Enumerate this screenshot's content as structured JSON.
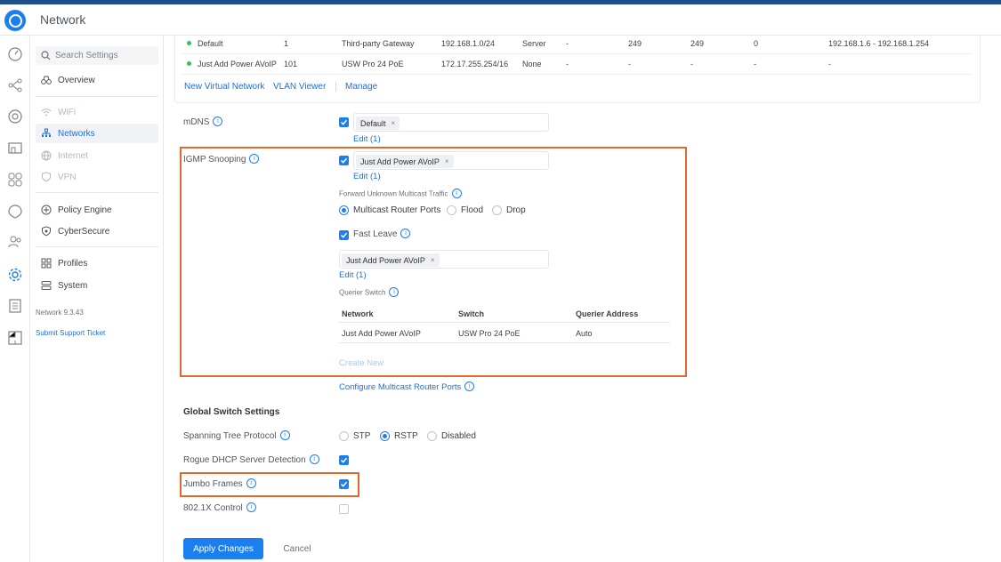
{
  "app": {
    "title": "Network"
  },
  "colors": {
    "accent": "#1c7ff0",
    "highlight": "#e0692d",
    "status_ok": "#3bbd5e"
  },
  "rail": {
    "icons": [
      "dashboard-icon",
      "topology-icon",
      "devices-icon",
      "clients-icon",
      "statistics-icon",
      "insights-icon",
      "users-icon",
      "settings-icon",
      "logs-icon",
      "innerspace-icon"
    ]
  },
  "sidebar": {
    "search_placeholder": "Search Settings",
    "items": [
      {
        "label": "Overview",
        "icon": "binoculars-icon"
      },
      {
        "label": "WiFi",
        "icon": "wifi-icon"
      },
      {
        "label": "Networks",
        "icon": "network-tree-icon"
      },
      {
        "label": "Internet",
        "icon": "globe-icon"
      },
      {
        "label": "VPN",
        "icon": "shield-icon"
      },
      {
        "label": "Policy Engine",
        "icon": "policy-icon"
      },
      {
        "label": "CyberSecure",
        "icon": "cybersecure-icon"
      },
      {
        "label": "Profiles",
        "icon": "profiles-icon"
      },
      {
        "label": "System",
        "icon": "system-icon"
      }
    ],
    "version": "Network 9.3.43",
    "support_link": "Submit Support Ticket"
  },
  "networks_table": {
    "rows": [
      [
        "Default",
        "1",
        "Third-party Gateway",
        "192.168.1.0/24",
        "Server",
        "-",
        "249",
        "249",
        "0",
        "192.168.1.6 - 192.168.1.254"
      ],
      [
        "Just Add Power AVoIP",
        "101",
        "USW Pro 24 PoE",
        "172.17.255.254/16",
        "None",
        "-",
        "-",
        "-",
        "-",
        "-"
      ]
    ],
    "links": {
      "new_network": "New Virtual Network",
      "vlan_viewer": "VLAN Viewer",
      "manage": "Manage"
    }
  },
  "mdns": {
    "label": "mDNS",
    "chip": "Default",
    "edit": "Edit (1)"
  },
  "igmp": {
    "label": "IGMP Snooping",
    "chip": "Just Add Power AVoIP",
    "edit": "Edit (1)",
    "forward_label": "Forward Unknown Multicast Traffic",
    "forward_options": [
      "Multicast Router Ports",
      "Flood",
      "Drop"
    ],
    "fast_leave_label": "Fast Leave",
    "fast_leave_chip": "Just Add Power AVoIP",
    "fast_leave_edit": "Edit (1)",
    "querier_label": "Querier Switch",
    "querier_headers": [
      "Network",
      "Switch",
      "Querier Address"
    ],
    "querier_row": [
      "Just Add Power AVoIP",
      "USW Pro 24 PoE",
      "Auto"
    ],
    "create_new": "Create New",
    "configure_link": "Configure Multicast Router Ports"
  },
  "global": {
    "title": "Global Switch Settings",
    "stp_label": "Spanning Tree Protocol",
    "stp_options": [
      "STP",
      "RSTP",
      "Disabled"
    ],
    "rogue_dhcp_label": "Rogue DHCP Server Detection",
    "jumbo_label": "Jumbo Frames",
    "dot1x_label": "802.1X Control"
  },
  "actions": {
    "apply": "Apply Changes",
    "cancel": "Cancel"
  }
}
